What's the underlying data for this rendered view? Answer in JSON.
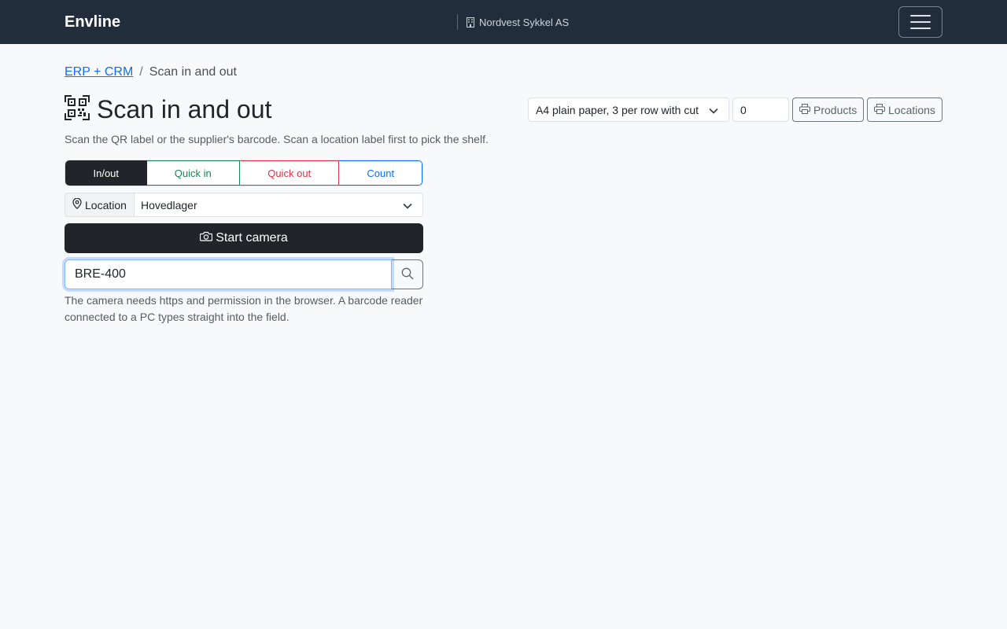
{
  "navbar": {
    "brand": "Envline",
    "company": "Nordvest Sykkel AS",
    "company_icon": "building-icon",
    "menu_icon": "hamburger-menu-icon"
  },
  "breadcrumb": {
    "parent": "ERP + CRM",
    "separator": "/",
    "current": "Scan in and out"
  },
  "page": {
    "title": "Scan in and out",
    "title_icon": "qr-code-icon",
    "subtitle": "Scan the QR label or the supplier's barcode. Scan a location label first to pick the shelf."
  },
  "toolbar": {
    "paper_format": "A4 plain paper, 3 per row with cut",
    "quantity": "0",
    "products_label": "Products",
    "locations_label": "Locations",
    "printer_icon": "printer-icon"
  },
  "modes": {
    "inout": "In/out",
    "quick_in": "Quick in",
    "quick_out": "Quick out",
    "count": "Count",
    "selected": "In/out"
  },
  "location": {
    "label": "Location",
    "value": "Hovedlager",
    "icon": "map-pin-icon"
  },
  "camera_button": {
    "label": "Start camera",
    "icon": "camera-icon"
  },
  "search": {
    "value": "BRE-400",
    "icon": "search-icon"
  },
  "help_text": "The camera needs https and permission in the browser. A barcode reader connected to a PC types straight into the field.",
  "colors": {
    "navbar_bg": "#212d3b",
    "primary": "#0d6efd",
    "success": "#198754",
    "danger": "#dc3545",
    "dark": "#212529"
  }
}
